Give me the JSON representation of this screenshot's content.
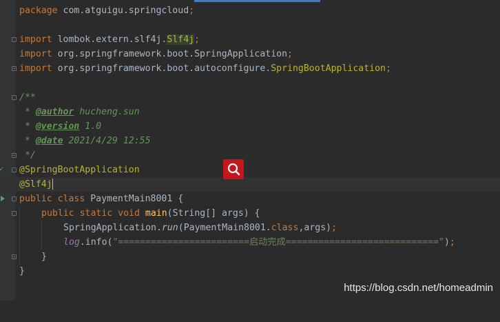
{
  "code": {
    "l1_pkg": "package",
    "l1_rest": " com.atguigu.springcloud",
    "l1_semi": ";",
    "l3_import": "import",
    "l3_path": " lombok.extern.slf4j.",
    "l3_cls": "Slf4j",
    "l3_semi": ";",
    "l4_import": "import",
    "l4_path": " org.springframework.boot.SpringApplication",
    "l4_semi": ";",
    "l5_import": "import",
    "l5_path": " org.springframework.boot.autoconfigure.",
    "l5_cls": "SpringBootApplication",
    "l5_semi": ";",
    "l7_open": "/**",
    "l8_pre": " * ",
    "l8_tag": "@author",
    "l8_val": " hucheng.sun",
    "l9_pre": " * ",
    "l9_tag": "@version",
    "l9_val": " 1.0",
    "l10_pre": " * ",
    "l10_tag": "@date",
    "l10_val": " 2021/4/29 12:55",
    "l11_close": " */",
    "l12_ann": "@SpringBootApplication",
    "l13_ann": "@Slf4j",
    "l14_kw": "public class",
    "l14_name": " PaymentMain8001 {",
    "l15_kw": "public static void",
    "l15_sp": " ",
    "l15_fn": "main",
    "l15_args": "(String[] args) {",
    "l16_a": "SpringApplication.",
    "l16_run": "run",
    "l16_b": "(PaymentMain8001.",
    "l16_class": "class",
    "l16_c": ",args)",
    "l16_semi": ";",
    "l17_log": "log",
    "l17_info": ".info(",
    "l17_str": "\"========================启动完成============================\"",
    "l17_end": ")",
    "l17_semi": ";",
    "l18_brace": "}",
    "l19_brace": "}"
  },
  "watermark": "https://blog.csdn.net/homeadmin",
  "colors": {
    "background": "#2b2b2b",
    "gutter": "#313335",
    "keyword": "#cc7832",
    "annotation": "#bbb529",
    "string": "#6a8759",
    "method": "#ffc66d",
    "field": "#9876aa",
    "search_badge": "#c4161c"
  },
  "icons": {
    "run_gutter": "run-triangle-icon",
    "spring_gutter": "spring-bean-icon",
    "search_badge": "magnifier-search-icon"
  }
}
